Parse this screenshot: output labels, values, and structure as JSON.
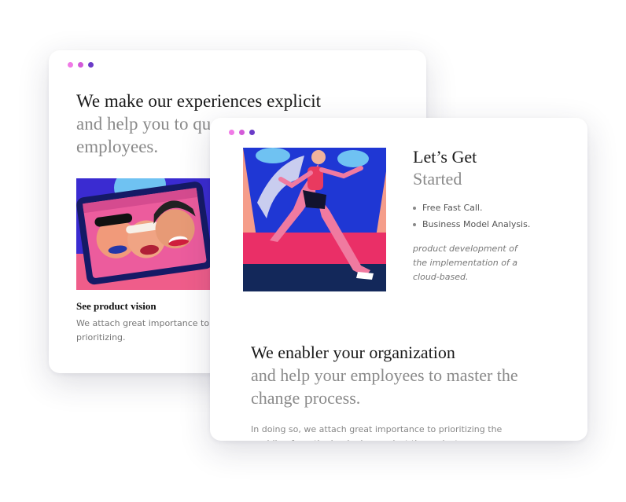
{
  "colors": {
    "dot_pink": "#f07ae6",
    "dot_magenta": "#d35ad8",
    "dot_purple": "#6a3bc7"
  },
  "back_card": {
    "heading_dark": "We make our experiences explicit",
    "heading_muted": "and help you to qu… employees.",
    "vision_title": "See product vision",
    "vision_desc": "We attach great importance to prioritizing."
  },
  "front_card": {
    "title_dark": "Let’s Get",
    "title_muted": "Started",
    "features": [
      "Free Fast Call.",
      "Business Model Analysis."
    ],
    "note": "product development of the implementation of a cloud-based.",
    "heading_dark": "We enabler your organization",
    "heading_muted": "and help your employees to master the change process.",
    "paragraph": "In doing so, we attach great importance to prioritizing the enabling from the beginning against the project progress."
  }
}
